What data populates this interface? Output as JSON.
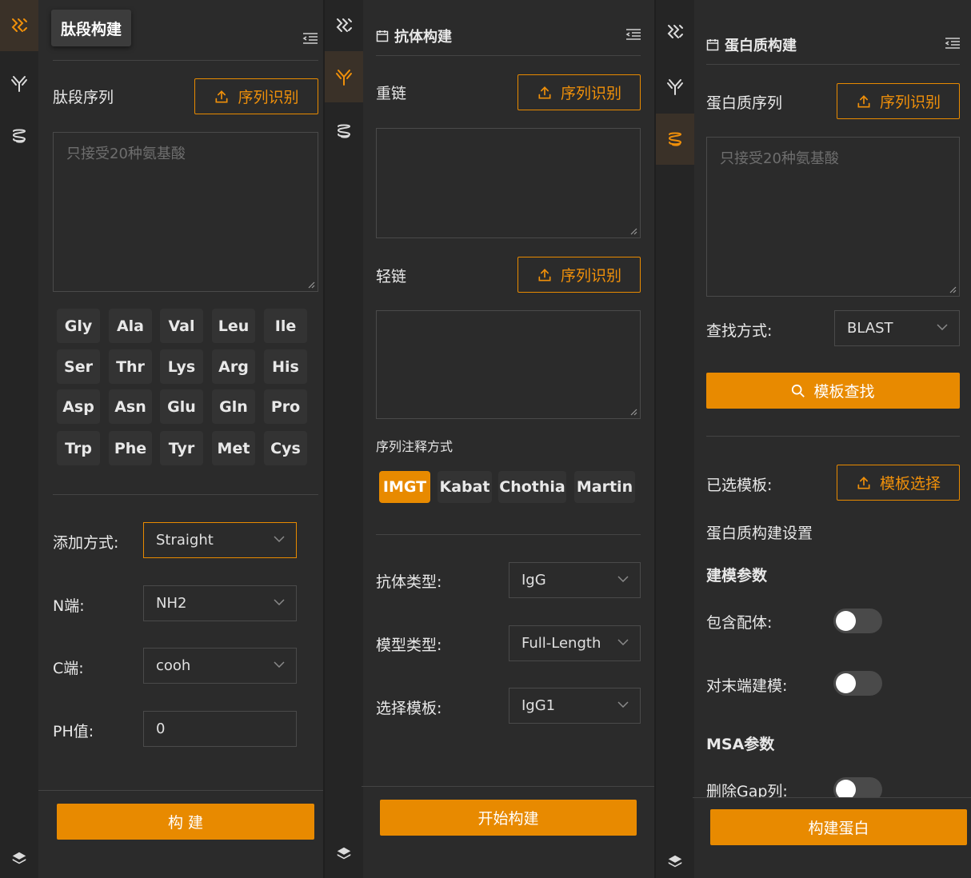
{
  "nav": {
    "tooltip": "肽段构建",
    "icons": [
      "peptide-icon",
      "antibody-icon",
      "protein-icon",
      "layers-icon"
    ]
  },
  "peptide": {
    "seq_label": "肽段序列",
    "recognize_btn": "序列识别",
    "placeholder": "只接受20种氨基酸",
    "amino_acids": [
      "Gly",
      "Ala",
      "Val",
      "Leu",
      "Ile",
      "Ser",
      "Thr",
      "Lys",
      "Arg",
      "His",
      "Asp",
      "Asn",
      "Glu",
      "Gln",
      "Pro",
      "Trp",
      "Phe",
      "Tyr",
      "Met",
      "Cys"
    ],
    "add_mode_label": "添加方式:",
    "add_mode_value": "Straight",
    "n_term_label": "N端:",
    "n_term_value": "NH2",
    "c_term_label": "C端:",
    "c_term_value": "cooh",
    "ph_label": "PH值:",
    "ph_value": "0",
    "build_btn": "构 建"
  },
  "antibody": {
    "title": "抗体构建",
    "heavy_label": "重链",
    "light_label": "轻链",
    "recognize_btn": "序列识别",
    "annotation_label": "序列注释方式",
    "schemes": [
      "IMGT",
      "Kabat",
      "Chothia",
      "Martin"
    ],
    "active_scheme": "IMGT",
    "type_label": "抗体类型:",
    "type_value": "IgG",
    "model_label": "模型类型:",
    "model_value": "Full-Length",
    "template_label": "选择模板:",
    "template_value": "IgG1",
    "start_btn": "开始构建"
  },
  "protein": {
    "title": "蛋白质构建",
    "seq_label": "蛋白质序列",
    "recognize_btn": "序列识别",
    "placeholder": "只接受20种氨基酸",
    "search_label": "查找方式:",
    "search_value": "BLAST",
    "template_search_btn": "模板查找",
    "selected_label": "已选模板:",
    "template_select_btn": "模板选择",
    "settings_label": "蛋白质构建设置",
    "modeling_params": "建模参数",
    "include_ligand_label": "包含配体:",
    "terminal_label": "对末端建模:",
    "msa_params": "MSA参数",
    "remove_gap_label": "删除Gap列:",
    "build_btn": "构建蛋白"
  },
  "colors": {
    "accent": "#e88a00",
    "bg": "#2b2b2b",
    "rail": "#252525"
  }
}
